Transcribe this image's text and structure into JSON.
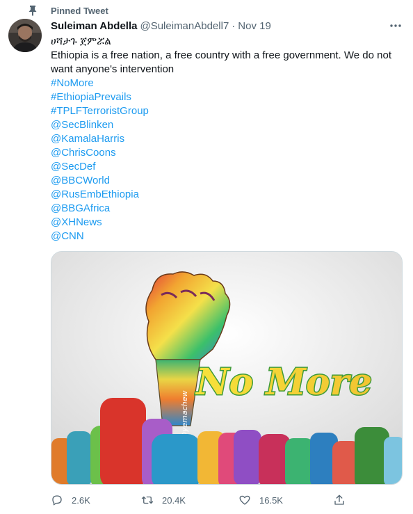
{
  "pinned": {
    "label": "Pinned Tweet",
    "icon": "pin-icon"
  },
  "author": {
    "name": "Suleiman Abdella",
    "handle": "@SuleimanAbdell7",
    "separator": "·",
    "date": "Nov 19"
  },
  "tweet": {
    "lines": [
      "ሀሻታጉ ጀምሯል",
      "Ethiopia is a free nation, a free country with a free government.  We do not",
      "want anyone's intervention"
    ],
    "links": [
      "#NoMore",
      "#EthiopiaPrevails",
      "#TPLFTerroristGroup",
      "@SecBlinken",
      "@KamalaHarris",
      "@ChrisCoons",
      "@SecDef",
      "@BBCWorld",
      "@RusEmbEthiopia",
      "@BBGAfrica",
      "@XHNews",
      "@CNN"
    ],
    "link_color": "#1d9bf0"
  },
  "media": {
    "overlay_text": "No More",
    "signature": "@yemachew",
    "icons": [
      "raised-fist-icon"
    ]
  },
  "actions": {
    "replies": "2.6K",
    "retweets": "20.4K",
    "likes": "16.5K"
  }
}
